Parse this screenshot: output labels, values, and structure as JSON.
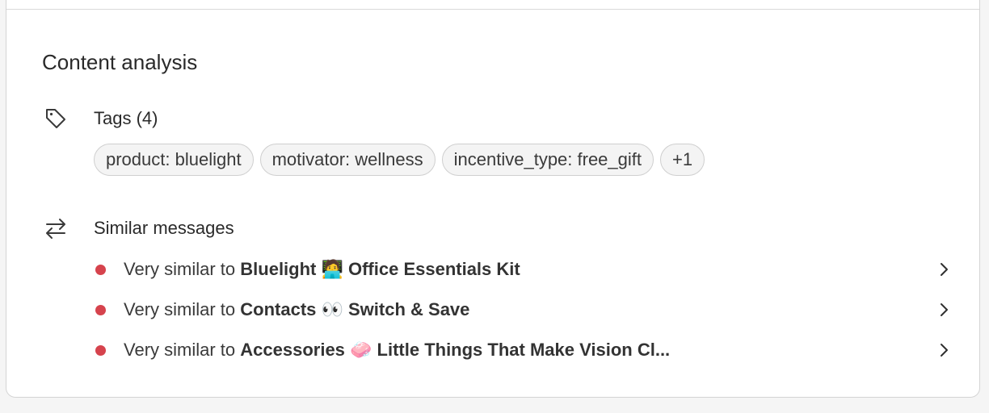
{
  "panel": {
    "title": "Content analysis"
  },
  "tags_section": {
    "icon": "tag-icon",
    "label": "Tags (4)",
    "tags": [
      "product: bluelight",
      "motivator: wellness",
      "incentive_type: free_gift",
      "+1"
    ]
  },
  "similar_section": {
    "icon": "arrows-swap-icon",
    "label": "Similar messages",
    "items": [
      {
        "prefix": "Very similar to ",
        "name": "Bluelight 🧑‍💻 Office Essentials Kit",
        "indicator_color": "#d6434d"
      },
      {
        "prefix": "Very similar to ",
        "name": "Contacts 👀 Switch & Save",
        "indicator_color": "#d6434d"
      },
      {
        "prefix": "Very similar to ",
        "name": "Accessories 🧼 Little Things That Make Vision Cl...",
        "indicator_color": "#d6434d"
      }
    ]
  }
}
